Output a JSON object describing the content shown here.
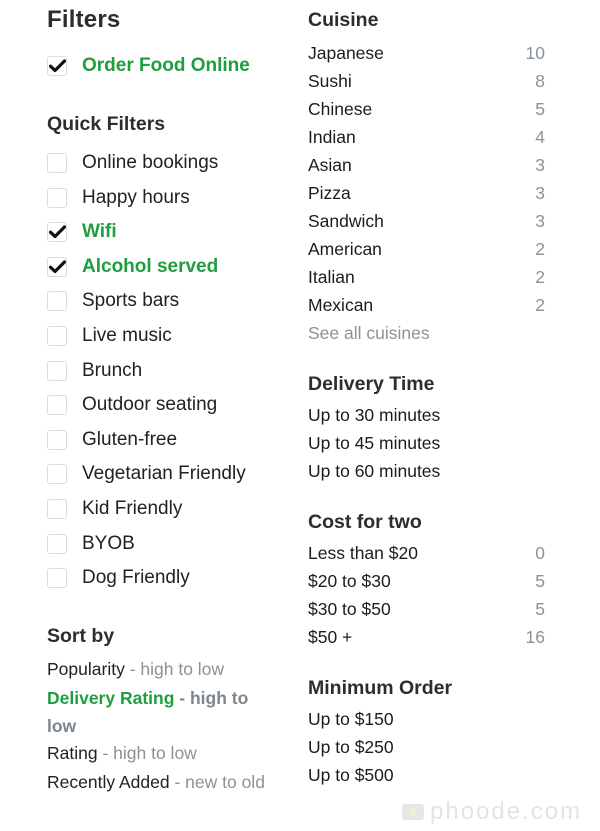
{
  "filters_title": "Filters",
  "order_online": {
    "label": "Order Food Online",
    "checked": true
  },
  "quick_filters": {
    "title": "Quick Filters",
    "items": [
      {
        "label": "Online bookings",
        "checked": false
      },
      {
        "label": "Happy hours",
        "checked": false
      },
      {
        "label": "Wifi",
        "checked": true
      },
      {
        "label": "Alcohol served",
        "checked": true
      },
      {
        "label": "Sports bars",
        "checked": false
      },
      {
        "label": "Live music",
        "checked": false
      },
      {
        "label": "Brunch",
        "checked": false
      },
      {
        "label": "Outdoor seating",
        "checked": false
      },
      {
        "label": "Gluten-free",
        "checked": false
      },
      {
        "label": "Vegetarian Friendly",
        "checked": false
      },
      {
        "label": "Kid Friendly",
        "checked": false
      },
      {
        "label": "BYOB",
        "checked": false
      },
      {
        "label": "Dog Friendly",
        "checked": false
      }
    ]
  },
  "sort_by": {
    "title": "Sort by",
    "separator": " - ",
    "items": [
      {
        "name": "Popularity",
        "direction": "high to low",
        "selected": false
      },
      {
        "name": "Delivery Rating",
        "direction": "high to low",
        "selected": true
      },
      {
        "name": "Rating",
        "direction": "high to low",
        "selected": false
      },
      {
        "name": "Recently Added",
        "direction": "new to old",
        "selected": false
      }
    ]
  },
  "cuisine": {
    "title": "Cuisine",
    "items": [
      {
        "label": "Japanese",
        "count": "10"
      },
      {
        "label": "Sushi",
        "count": "8"
      },
      {
        "label": "Chinese",
        "count": "5"
      },
      {
        "label": "Indian",
        "count": "4"
      },
      {
        "label": "Asian",
        "count": "3"
      },
      {
        "label": "Pizza",
        "count": "3"
      },
      {
        "label": "Sandwich",
        "count": "3"
      },
      {
        "label": "American",
        "count": "2"
      },
      {
        "label": "Italian",
        "count": "2"
      },
      {
        "label": "Mexican",
        "count": "2"
      }
    ],
    "see_all": "See all cuisines"
  },
  "delivery_time": {
    "title": "Delivery Time",
    "items": [
      "Up to 30 minutes",
      "Up to 45 minutes",
      "Up to 60 minutes"
    ]
  },
  "cost_for_two": {
    "title": "Cost for two",
    "items": [
      {
        "label": "Less than $20",
        "count": "0"
      },
      {
        "label": "$20 to $30",
        "count": "5"
      },
      {
        "label": "$30 to $50",
        "count": "5"
      },
      {
        "label": "$50 +",
        "count": "16"
      }
    ]
  },
  "minimum_order": {
    "title": "Minimum Order",
    "items": [
      "Up to $150",
      "Up to $250",
      "Up to $500"
    ]
  },
  "watermark": {
    "text": "phoode.com",
    "icon": "camera-icon"
  },
  "colors": {
    "accent_green": "#1e9e3e",
    "muted_gray": "#8a9299",
    "text_dark": "#222222"
  }
}
